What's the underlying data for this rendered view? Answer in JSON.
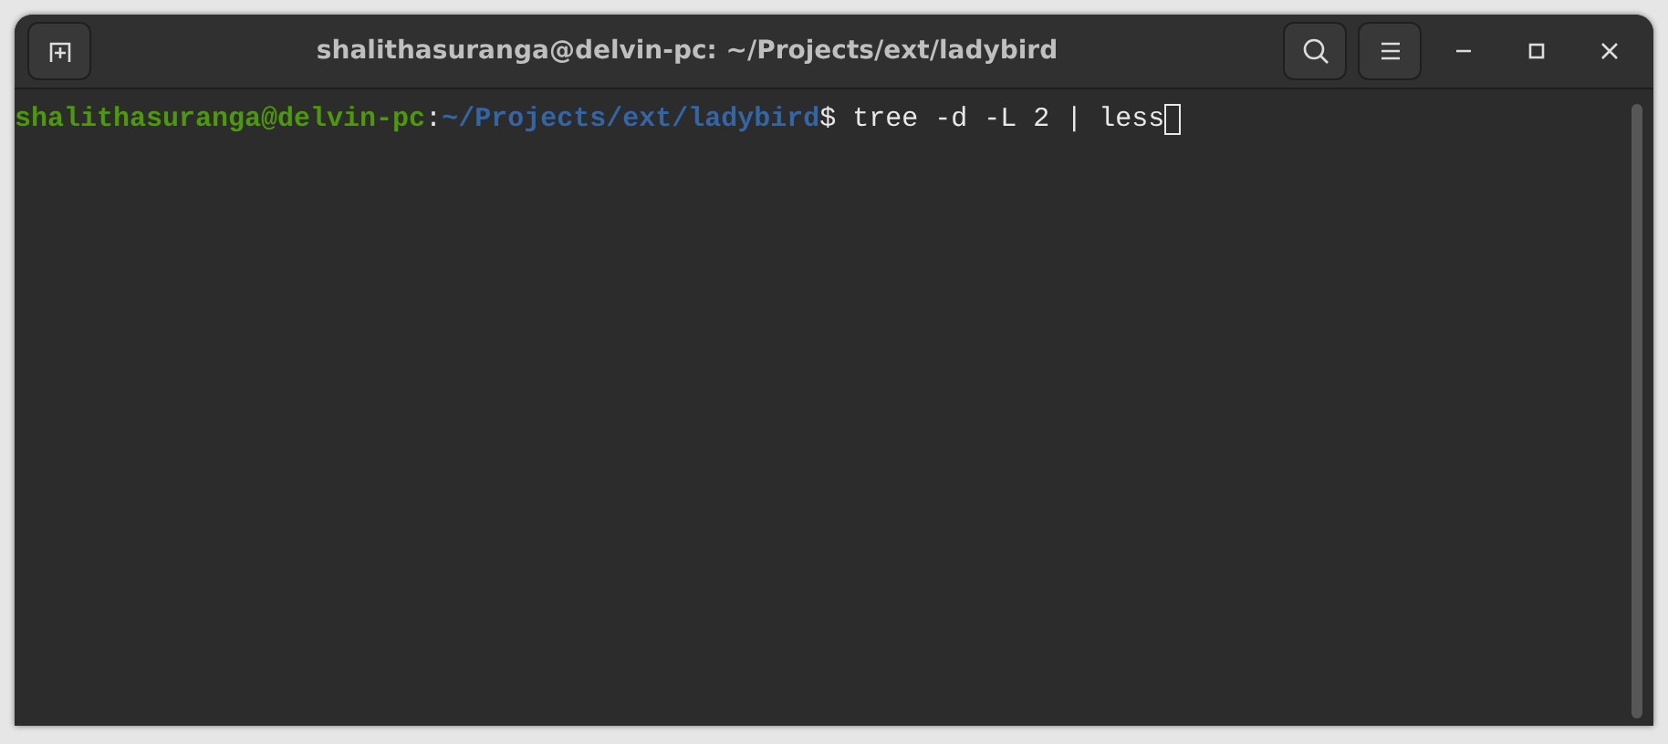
{
  "window": {
    "title": "shalithasuranga@delvin-pc: ~/Projects/ext/ladybird"
  },
  "terminal": {
    "lines": [
      {
        "segments": [
          {
            "kind": "user",
            "text": "shalithasuranga@delvin-pc"
          },
          {
            "kind": "plain",
            "text": ":"
          },
          {
            "kind": "path",
            "text": "~/Projects/ext/ladybird"
          },
          {
            "kind": "plain",
            "text": "$ tree -d -L 2 | less"
          }
        ],
        "cursor": true
      }
    ]
  }
}
